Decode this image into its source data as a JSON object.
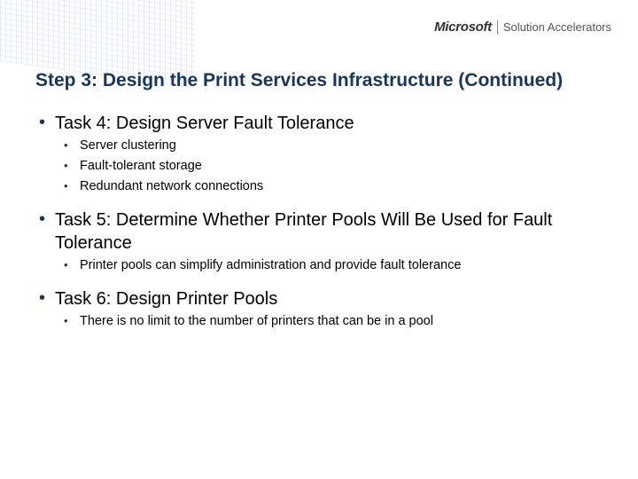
{
  "brand": {
    "microsoft": "Microsoft",
    "solution_accelerators": "Solution Accelerators"
  },
  "title": "Step 3: Design the Print Services Infrastructure (Continued)",
  "bullets": [
    {
      "text": "Task 4: Design Server Fault Tolerance",
      "sub": [
        "Server clustering",
        "Fault-tolerant storage",
        "Redundant network connections"
      ]
    },
    {
      "text": "Task 5: Determine Whether Printer Pools Will Be Used for Fault Tolerance",
      "sub": [
        "Printer pools can simplify administration and provide fault tolerance"
      ]
    },
    {
      "text": "Task 6: Design Printer Pools",
      "sub": [
        "There is no limit to the number of printers that can be in a pool"
      ]
    }
  ]
}
